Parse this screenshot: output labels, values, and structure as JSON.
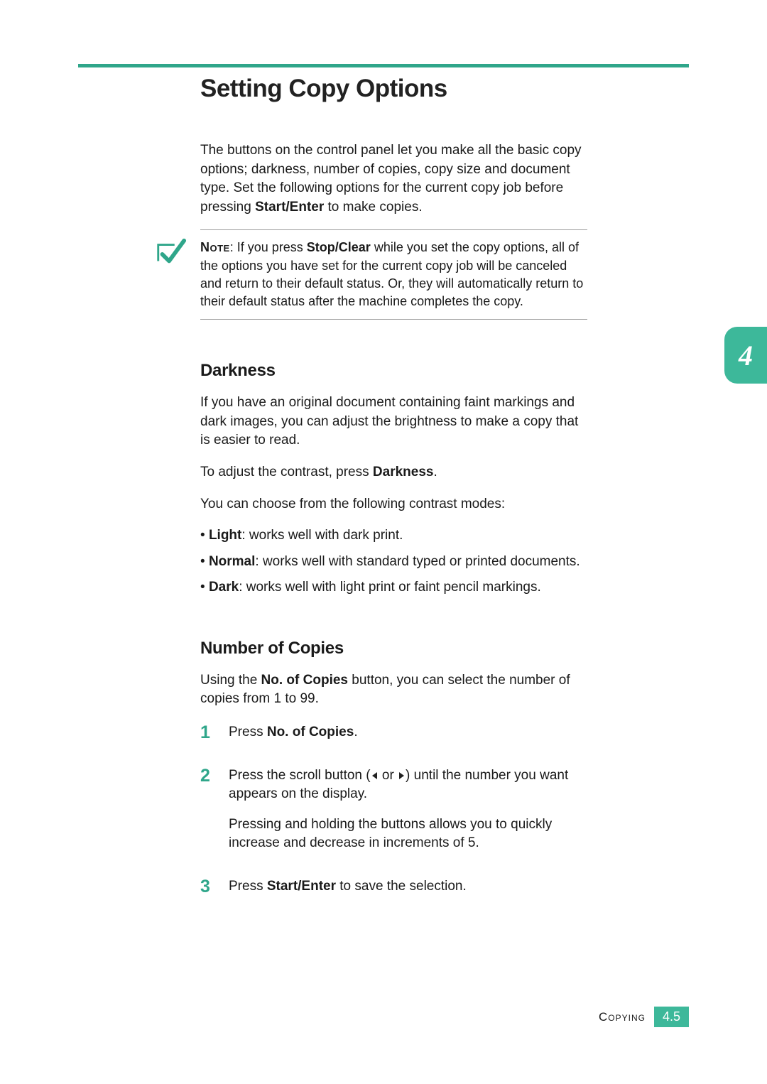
{
  "tab_number": "4",
  "title": "Setting Copy Options",
  "intro": {
    "text": "The buttons on the control panel let you make all the basic copy options; darkness, number of copies, copy size and document type. Set the following options for the current copy job before pressing ",
    "bold": "Start/Enter",
    "after": " to make copies."
  },
  "note": {
    "label": "Note",
    "pre": ": If you press ",
    "bold": "Stop/Clear",
    "post": " while you set the copy options, all of the options you have set for the current copy job will be canceled and return to their default status. Or, they will automatically return to their default status after the machine completes the copy."
  },
  "darkness": {
    "heading": "Darkness",
    "p1": "If you have an original document containing faint markings and dark images, you can adjust the brightness to make a copy that is easier to read.",
    "p2_pre": "To adjust the contrast, press ",
    "p2_bold": "Darkness",
    "p2_post": ".",
    "p3": "You can choose from the following contrast modes:",
    "items": [
      {
        "bold": "Light",
        "rest": ": works well with dark print."
      },
      {
        "bold": "Normal",
        "rest": ": works well with standard typed or printed documents."
      },
      {
        "bold": "Dark",
        "rest": ": works well with light print or faint pencil markings."
      }
    ]
  },
  "copies": {
    "heading": "Number of Copies",
    "intro_pre": "Using the ",
    "intro_bold": "No. of Copies",
    "intro_post": " button, you can select the number of copies from 1 to 99.",
    "step1_pre": "Press ",
    "step1_bold": "No. of Copies",
    "step1_post": ".",
    "step2_pre": "Press the scroll button (",
    "step2_mid": " or ",
    "step2_post": ") until the number you want appears on the display.",
    "step2_p2": "Pressing and holding the buttons allows you to quickly increase and decrease in increments of 5.",
    "step3_pre": "Press ",
    "step3_bold": "Start/Enter",
    "step3_post": " to save the selection."
  },
  "footer": {
    "section": "Copying",
    "page": "4.5"
  }
}
